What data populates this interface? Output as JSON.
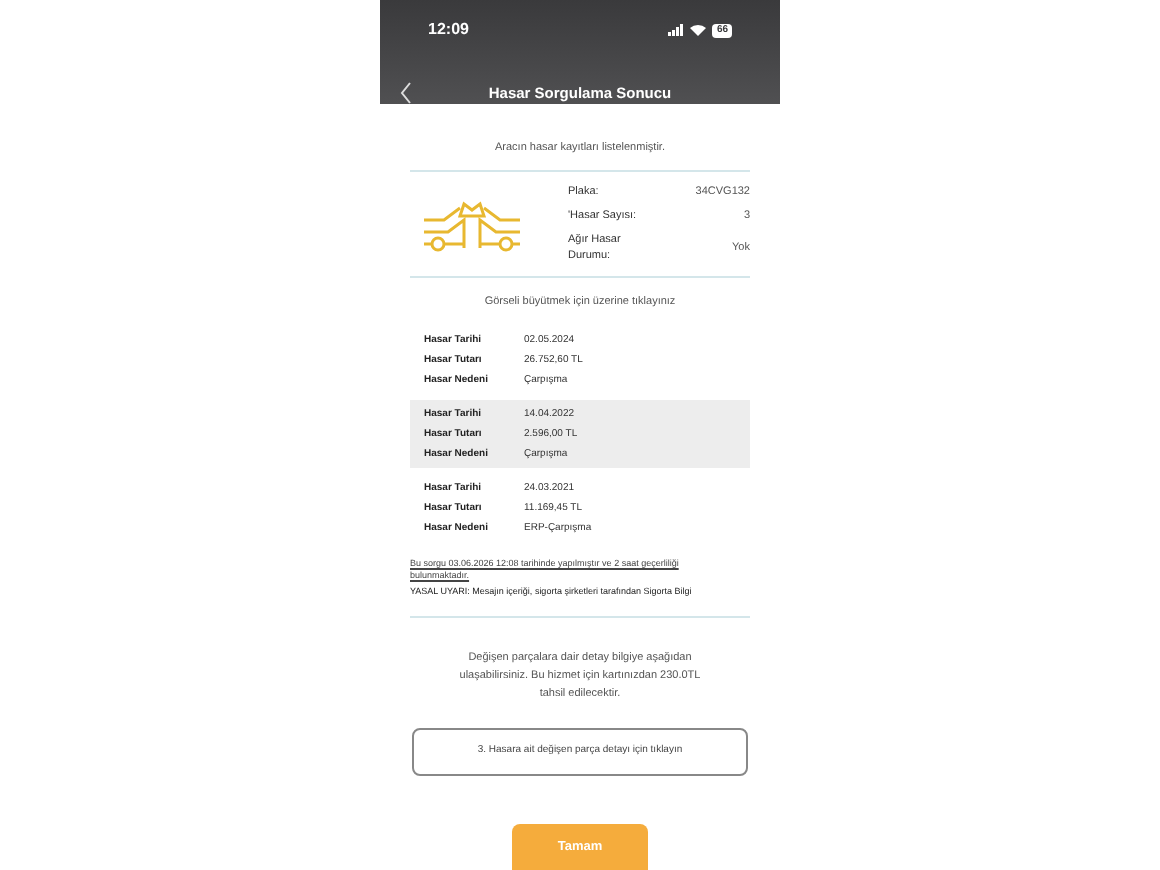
{
  "status_bar": {
    "time": "12:09",
    "battery": "66"
  },
  "header": {
    "title": "Hasar Sorgulama Sonucu"
  },
  "intro": "Aracın hasar kayıtları listelenmiştir.",
  "summary": [
    {
      "label": "Plaka:",
      "value": "34CVG132"
    },
    {
      "label": "'Hasar Sayısı:",
      "value": "3"
    },
    {
      "label": "Ağır Hasar Durumu:",
      "value": "Yok"
    }
  ],
  "image_hint": "Görseli büyütmek için üzerine tıklayınız",
  "records": [
    {
      "highlighted": false,
      "rows": [
        {
          "label": "Hasar Tarihi",
          "value": "02.05.2024"
        },
        {
          "label": "Hasar Tutarı",
          "value": "26.752,60 TL"
        },
        {
          "label": "Hasar Nedeni",
          "value": "Çarpışma"
        }
      ]
    },
    {
      "highlighted": true,
      "rows": [
        {
          "label": "Hasar Tarihi",
          "value": "14.04.2022"
        },
        {
          "label": "Hasar Tutarı",
          "value": "2.596,00 TL"
        },
        {
          "label": "Hasar Nedeni",
          "value": "Çarpışma"
        }
      ]
    },
    {
      "highlighted": false,
      "rows": [
        {
          "label": "Hasar Tarihi",
          "value": "24.03.2021"
        },
        {
          "label": "Hasar Tutarı",
          "value": "11.169,45 TL"
        },
        {
          "label": "Hasar Nedeni",
          "value": "ERP-Çarpışma"
        }
      ]
    }
  ],
  "query_note": "Bu sorgu 03.06.2026 12:08 tarihinde yapılmıştır ve 2 saat geçerliliği bulunmaktadır.",
  "legal_note": "YASAL UYARI: Mesajın içeriği, sigorta şirketleri tarafından Sigorta Bilgi",
  "parts_info": "Değişen parçalara dair detay bilgiye aşağıdan ulaşabilirsiniz. Bu hizmet için kartınızdan 230.0TL tahsil edilecektir.",
  "parts_button": "3. Hasara ait değişen parça detayı için tıklayın",
  "ok_button": "Tamam"
}
